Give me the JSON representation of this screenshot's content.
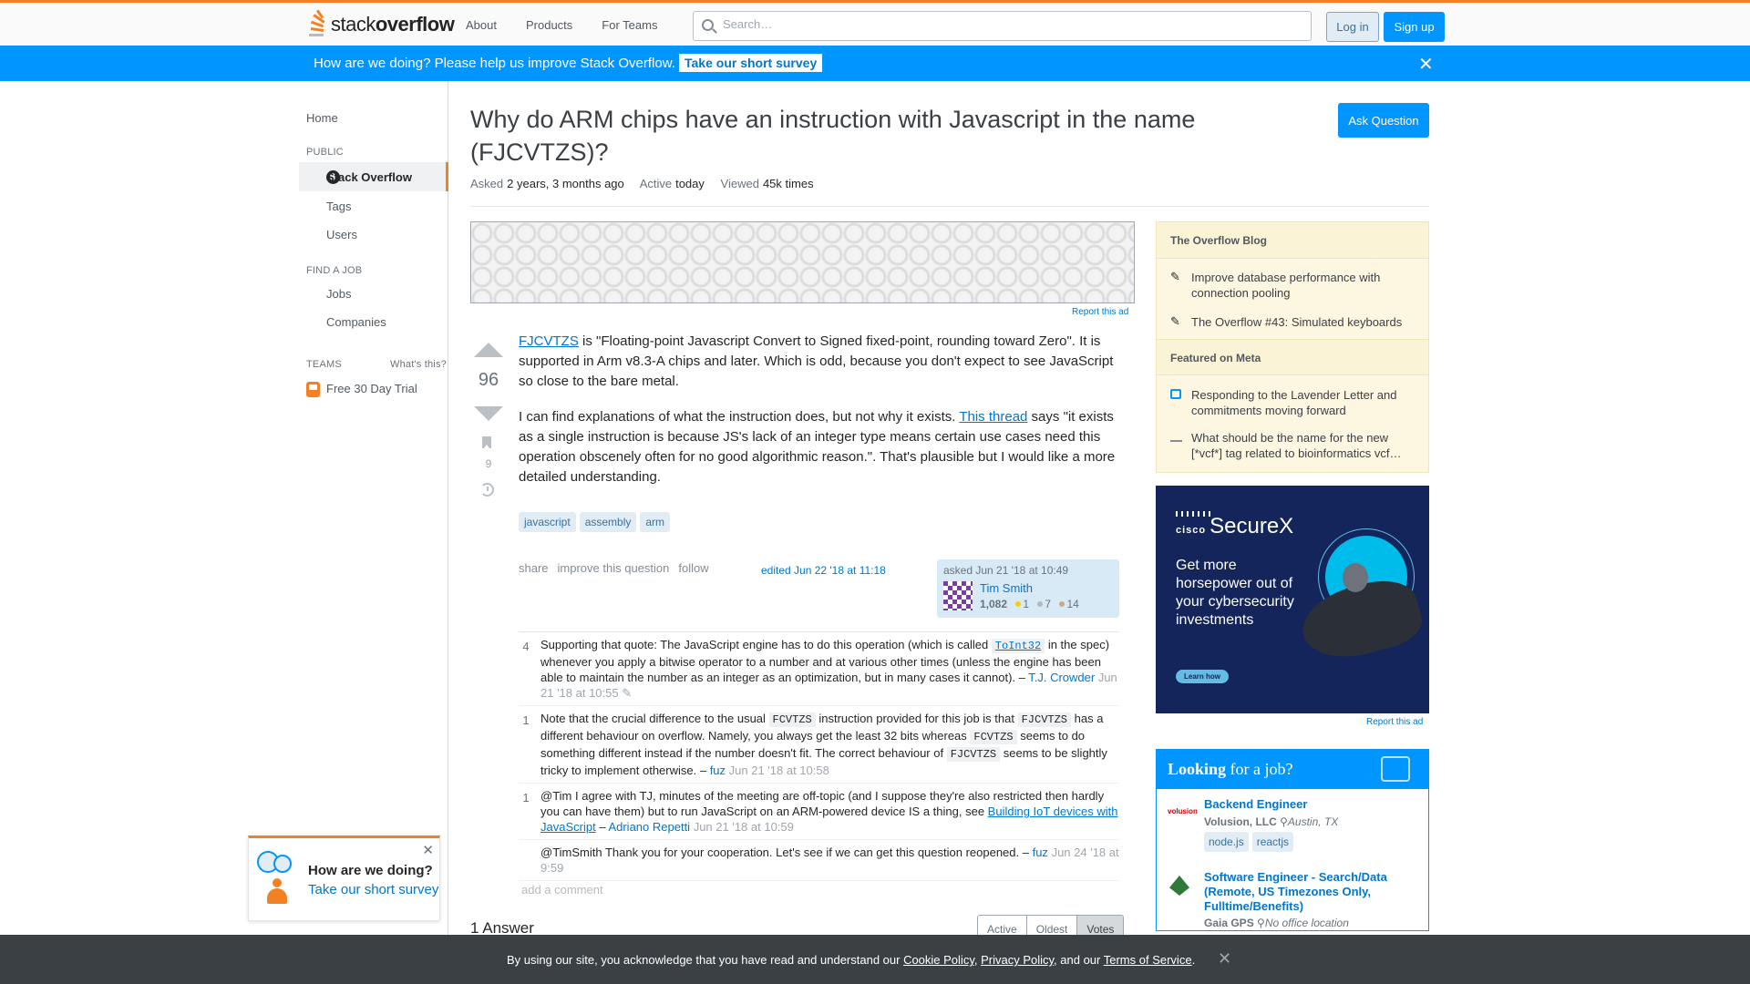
{
  "header": {
    "logo_light": "stack",
    "logo_bold": "overflow",
    "nav": [
      "About",
      "Products",
      "For Teams"
    ],
    "search_placeholder": "Search…",
    "login": "Log in",
    "signup": "Sign up"
  },
  "survey_banner": {
    "text": "How are we doing? Please help us improve Stack Overflow.",
    "cta": "Take our short survey"
  },
  "sidebar": {
    "home": "Home",
    "public_heading": "PUBLIC",
    "stack_overflow": "Stack Overflow",
    "tags": "Tags",
    "users": "Users",
    "find_job_heading": "FIND A JOB",
    "jobs": "Jobs",
    "companies": "Companies",
    "teams_heading": "TEAMS",
    "whats_this": "What's this?",
    "free_trial": "Free 30 Day Trial"
  },
  "feedback": {
    "question": "How are we doing?",
    "link": "Take our short survey"
  },
  "question": {
    "title": "Why do ARM chips have an instruction with Javascript in the name (FJCVTZS)?",
    "ask_button": "Ask Question",
    "asked_label": "Asked",
    "asked_value": "2 years, 3 months ago",
    "active_label": "Active",
    "active_value": "today",
    "viewed_label": "Viewed",
    "viewed_value": "45k times",
    "votes": "96",
    "bookmarks": "9",
    "p1_link": "FJCVTZS",
    "p1_text": " is \"Floating-point Javascript Convert to Signed fixed-point, rounding toward Zero\". It is supported in Arm v8.3-A chips and later. Which is odd, because you don't expect to see JavaScript so close to the bare metal.",
    "p2_text_a": "I can find explanations of what the instruction does, but not why it exists. ",
    "p2_link": "This thread",
    "p2_text_b": " says \"it exists as a single instruction is because JS's lack of an integer type means certain use cases need this operation obscenely often for no good algorithmic reason.\". That's plausible but I would like a more detailed understanding.",
    "tags": [
      "javascript",
      "assembly",
      "arm"
    ],
    "menu": [
      "share",
      "improve this question",
      "follow"
    ],
    "edited": "edited Jun 22 '18 at 11:18",
    "owner_asked": "asked Jun 21 '18 at 10:49",
    "owner_name": "Tim Smith",
    "owner_rep": "1,082",
    "owner_gold": "1",
    "owner_silver": "7",
    "owner_bronze": "14"
  },
  "comments": [
    {
      "score": "4",
      "text_a": "Supporting that quote: The JavaScript engine has to do this operation (which is called ",
      "code": "ToInt32",
      "text_b": " in the spec) whenever you apply a bitwise operator to a number and at various other times (unless the engine has been able to maintain the number as an integer as an optimization, but in many cases it cannot). – ",
      "user": "T.J. Crowder",
      "date": "Jun 21 '18 at 10:55"
    },
    {
      "score": "1",
      "t1": "Note that the crucial difference to the usual ",
      "c1": "FCVTZS",
      "t2": " instruction provided for this job is that ",
      "c2": "FJCVTZS",
      "t3": " has a different behaviour on overflow. Namely, you always get the least 32 bits whereas ",
      "c3": "FCVTZS",
      "t4": " seems to do something different instead if the number doesn't fit. The correct behaviour of ",
      "c4": "FJCVTZS",
      "t5": " seems to be slightly tricky to implement otherwise. – ",
      "user": "fuz",
      "date": "Jun 21 '18 at 10:58"
    },
    {
      "score": "1",
      "text_a": "@Tim I agree with TJ, minutes of the meeting are off-topic (and I suppose they're also restricted then hardly you can have them) but to run JavaScript on an ARM-powered device IS a thing, see ",
      "link": "Building IoT devices with JavaScript",
      "text_b": " – ",
      "user": "Adriano Repetti",
      "date": "Jun 21 '18 at 10:59"
    },
    {
      "score": "",
      "text_a": "@TimSmith Thank you for your cooperation. Let's see if we can get this question reopened. – ",
      "user": "fuz",
      "date": "Jun 24 '18 at 9:59"
    }
  ],
  "add_comment": "add a comment",
  "answers": {
    "count": "1 Answer",
    "sort": [
      "Active",
      "Oldest",
      "Votes"
    ]
  },
  "report_ad": "Report this ad",
  "blog": {
    "heading": "The Overflow Blog",
    "items": [
      "Improve database performance with connection pooling",
      "The Overflow #43: Simulated keyboards"
    ],
    "meta_heading": "Featured on Meta",
    "meta_items": [
      "Responding to the Lavender Letter and commitments moving forward",
      "What should be the name for the new [*vcf*] tag related to bioinformatics vcf…"
    ]
  },
  "cisco_ad": {
    "brand_small": "cisco",
    "brand": "SecureX",
    "copy": "Get more horsepower out of your cybersecurity investments",
    "button": "Learn how"
  },
  "jobs": {
    "heading_bold": "Looking",
    "heading_rest": " for a job?",
    "items": [
      {
        "logo": "volusion",
        "title": "Backend Engineer",
        "company": "Volusion, LLC",
        "location": "Austin, TX",
        "tags": [
          "node.js",
          "reactjs"
        ]
      },
      {
        "title": "Software Engineer - Search/Data (Remote, US Timezones Only, Fulltime/Benefits)",
        "company": "Gaia GPS",
        "location": "No office location"
      }
    ]
  },
  "cookie": {
    "text_a": "By using our site, you acknowledge that you have read and understand our ",
    "cookie_policy": "Cookie Policy",
    "sep1": ", ",
    "privacy_policy": "Privacy Policy",
    "sep2": ", and our ",
    "terms": "Terms of Service",
    "end": "."
  }
}
